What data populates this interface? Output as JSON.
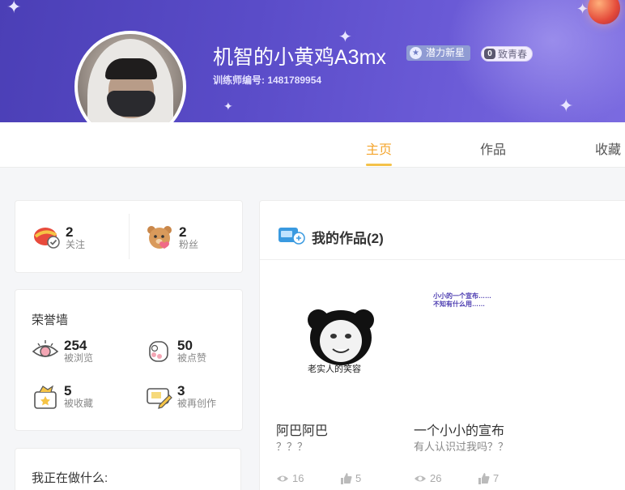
{
  "profile": {
    "username": "机智的小黄鸡A3mx",
    "badge_star": "潜力新星",
    "badge_youth_count": "0",
    "badge_youth": "致青春",
    "trainer_id": "训练师编号: 1481789954"
  },
  "tabs": [
    {
      "label": "主页",
      "active": true
    },
    {
      "label": "作品",
      "active": false
    },
    {
      "label": "收藏",
      "active": false
    }
  ],
  "follow": {
    "following_count": "2",
    "following_label": "关注",
    "fans_count": "2",
    "fans_label": "粉丝"
  },
  "honor": {
    "title": "荣誉墙",
    "views_count": "254",
    "views_label": "被浏览",
    "likes_count": "50",
    "likes_label": "被点赞",
    "favorites_count": "5",
    "favorites_label": "被收藏",
    "remix_count": "3",
    "remix_label": "被再创作"
  },
  "doing": {
    "title": "我正在做什么:"
  },
  "works": {
    "title": "我的作品(2)",
    "items": [
      {
        "title": "阿巴阿巴",
        "desc": "？？？",
        "views": "16",
        "likes": "5",
        "thumb_caption": "老实人的笑容"
      },
      {
        "title": "一个小小的宣布",
        "desc": "有人认识过我吗？？",
        "views": "26",
        "likes": "7",
        "thumb_line1": "小小的一个宣布……",
        "thumb_line2": "不知有什么用……"
      }
    ]
  },
  "colors": {
    "banner": "#5a4cc8",
    "accent": "#f4a52c"
  }
}
